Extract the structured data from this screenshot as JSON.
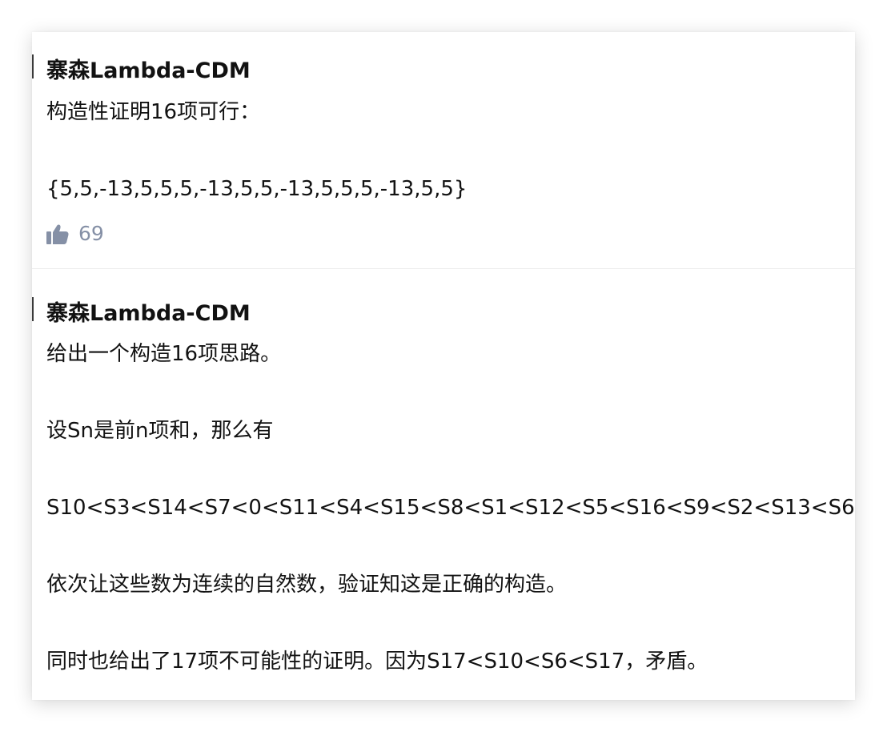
{
  "answers": [
    {
      "author": "寨森Lambda-CDM",
      "paragraphs": [
        "构造性证明16项可行：",
        "{5,5,-13,5,5,5,-13,5,5,-13,5,5,5,-13,5,5}"
      ],
      "vote_count": "69",
      "vote_icon": "thumbs-up-icon"
    },
    {
      "author": "寨森Lambda-CDM",
      "paragraphs": [
        "给出一个构造16项思路。",
        "设Sn是前n项和，那么有",
        "S10<S3<S14<S7<0<S11<S4<S15<S8<S1<S12<S5<S16<S9<S2<S13<S6",
        "依次让这些数为连续的自然数，验证知这是正确的构造。",
        "同时也给出了17项不可能性的证明。因为S17<S10<S6<S17，矛盾。"
      ]
    }
  ],
  "colors": {
    "text": "#121212",
    "meta": "#8590a6",
    "divider": "#ebebeb"
  }
}
